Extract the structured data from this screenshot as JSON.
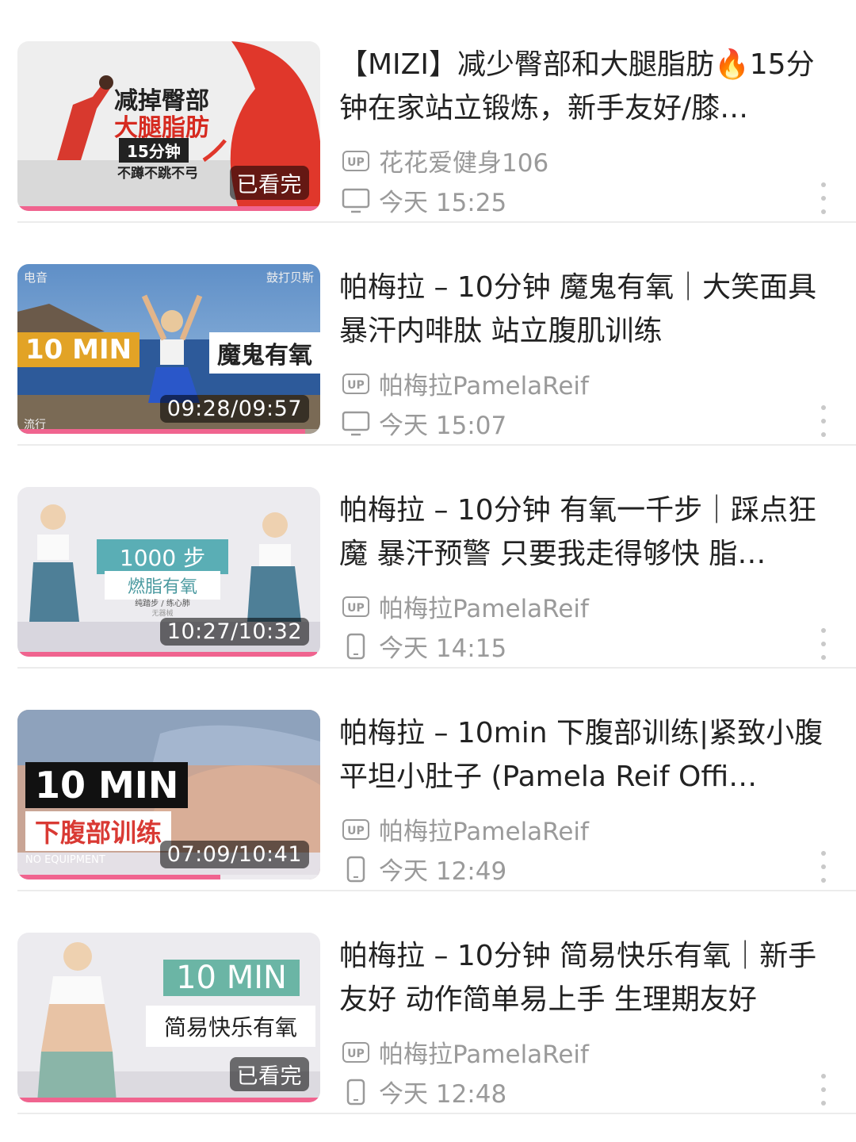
{
  "colors": {
    "accent": "#f0648f",
    "meta_text": "#9a9a9a",
    "title_text": "#222222"
  },
  "videos": [
    {
      "title": "【MIZI】减少臀部和大腿脂肪🔥15分钟在家站立锻炼，新手友好/膝…",
      "uploader": "花花爱健身106",
      "time": "今天 15:25",
      "device_icon": "monitor-icon",
      "badge": "已看完",
      "progress": 1.0,
      "thumb_text": {
        "line1": "减掉臀部",
        "line2": "大腿脂肪",
        "line3": "15分钟",
        "line4": "不蹲不跳不弓"
      }
    },
    {
      "title": "帕梅拉 – 10分钟 魔鬼有氧｜大笑面具 暴汗内啡肽 站立腹肌训练",
      "uploader": "帕梅拉PamelaReif",
      "time": "今天 15:07",
      "device_icon": "monitor-icon",
      "badge": "09:28/09:57",
      "progress": 0.95,
      "thumb_text": {
        "left_top": "电音",
        "right_top": "鼓打贝斯",
        "big": "10 MIN",
        "tag": "魔鬼有氧",
        "bottom_left": "流行"
      }
    },
    {
      "title": "帕梅拉 – 10分钟 有氧一千步｜踩点狂魔 暴汗预警 只要我走得够快 脂…",
      "uploader": "帕梅拉PamelaReif",
      "time": "今天 14:15",
      "device_icon": "phone-icon",
      "badge": "10:27/10:32",
      "progress": 0.99,
      "thumb_text": {
        "big": "1000 步",
        "tag": "燃脂有氧",
        "small": "纯踏步 / 练心肺",
        "tiny": "无器械"
      }
    },
    {
      "title": "帕梅拉 – 10min 下腹部训练|紧致小腹 平坦小肚子 (Pamela Reif Offi…",
      "uploader": "帕梅拉PamelaReif",
      "time": "今天 12:49",
      "device_icon": "phone-icon",
      "badge": "07:09/10:41",
      "progress": 0.67,
      "thumb_text": {
        "big": "10 MIN",
        "tag": "下腹部训练",
        "small": "NO EQUIPMENT"
      }
    },
    {
      "title": "帕梅拉 – 10分钟 简易快乐有氧｜新手友好 动作简单易上手 生理期友好",
      "uploader": "帕梅拉PamelaReif",
      "time": "今天 12:48",
      "device_icon": "phone-icon",
      "badge": "已看完",
      "progress": 1.0,
      "thumb_text": {
        "big": "10 MIN",
        "tag": "简易快乐有氧"
      }
    }
  ],
  "up_label": "UP"
}
